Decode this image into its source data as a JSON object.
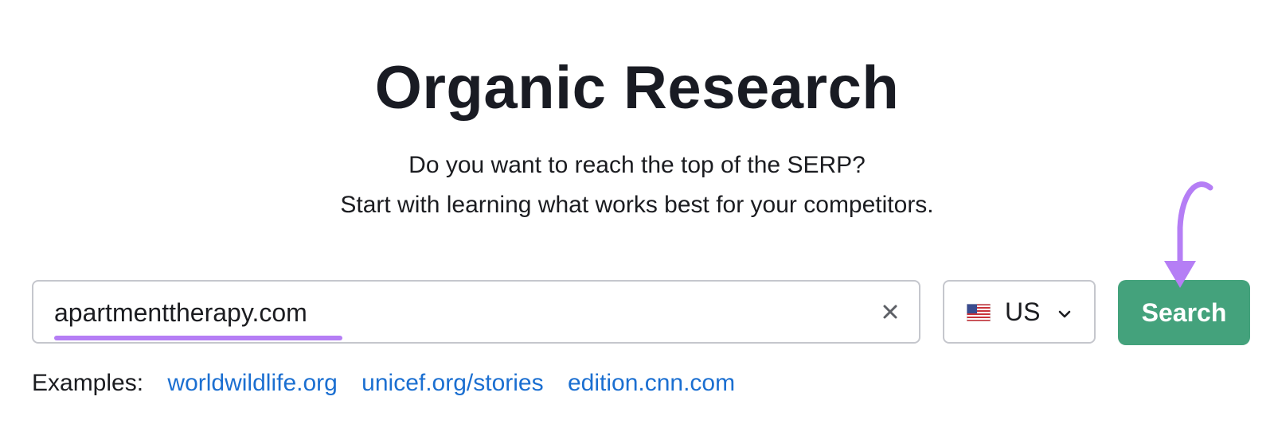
{
  "page": {
    "title": "Organic Research",
    "subtitle_line1": "Do you want to reach the top of the SERP?",
    "subtitle_line2": "Start with learning what works best for your competitors."
  },
  "search": {
    "value": "apartmenttherapy.com",
    "clear_icon": "close-icon",
    "underline_color": "#b57ef5"
  },
  "country": {
    "flag": "us-flag-icon",
    "label": "US",
    "dropdown_icon": "chevron-down-icon"
  },
  "search_button": {
    "label": "Search",
    "color": "#44a27c"
  },
  "annotation": {
    "icon": "arrow-down-icon",
    "color": "#b57ef5"
  },
  "examples": {
    "label": "Examples:",
    "links": [
      "worldwildlife.org",
      "unicef.org/stories",
      "edition.cnn.com"
    ],
    "link_color": "#1b6fd1"
  }
}
